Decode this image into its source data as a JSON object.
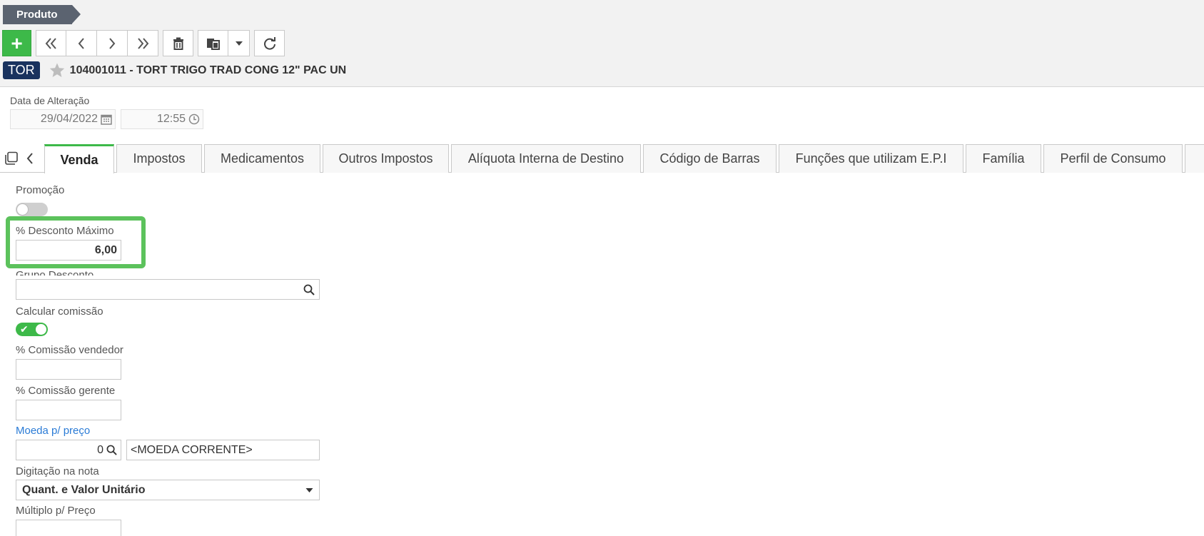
{
  "breadcrumb": {
    "label": "Produto"
  },
  "record": {
    "badge": "TOR",
    "title": "104001011 - TORT TRIGO TRAD CONG 12\" PAC UN"
  },
  "dates": {
    "label": "Data de Alteração",
    "date_value": "29/04/2022",
    "time_value": "12:55"
  },
  "tabs": [
    {
      "label": "Venda",
      "active": true
    },
    {
      "label": "Impostos"
    },
    {
      "label": "Medicamentos"
    },
    {
      "label": "Outros Impostos"
    },
    {
      "label": "Alíquota Interna de Destino"
    },
    {
      "label": "Código de Barras"
    },
    {
      "label": "Funções que utilizam E.P.I"
    },
    {
      "label": "Família"
    },
    {
      "label": "Perfil de Consumo"
    }
  ],
  "form": {
    "promocao": {
      "label": "Promoção",
      "value": false
    },
    "desconto_maximo": {
      "label": "% Desconto Máximo",
      "value": "6,00"
    },
    "grupo_desconto": {
      "label": "Grupo Desconto",
      "value": ""
    },
    "calcular_comissao": {
      "label": "Calcular comissão",
      "value": true
    },
    "comissao_vendedor": {
      "label": "% Comissão vendedor",
      "value": ""
    },
    "comissao_gerente": {
      "label": "% Comissão gerente",
      "value": ""
    },
    "moeda_preco": {
      "label": "Moeda p/ preço",
      "code": "0",
      "description": "<MOEDA CORRENTE>"
    },
    "digitacao_nota": {
      "label": "Digitação na nota",
      "value": "Quant. e Valor Unitário"
    },
    "multiplo_preco": {
      "label": "Múltiplo p/ Preço",
      "value": ""
    }
  },
  "colors": {
    "accent_green": "#3db949",
    "badge_navy": "#19325e",
    "highlight_green": "#5cc25c",
    "link_blue": "#2a7bd6"
  }
}
